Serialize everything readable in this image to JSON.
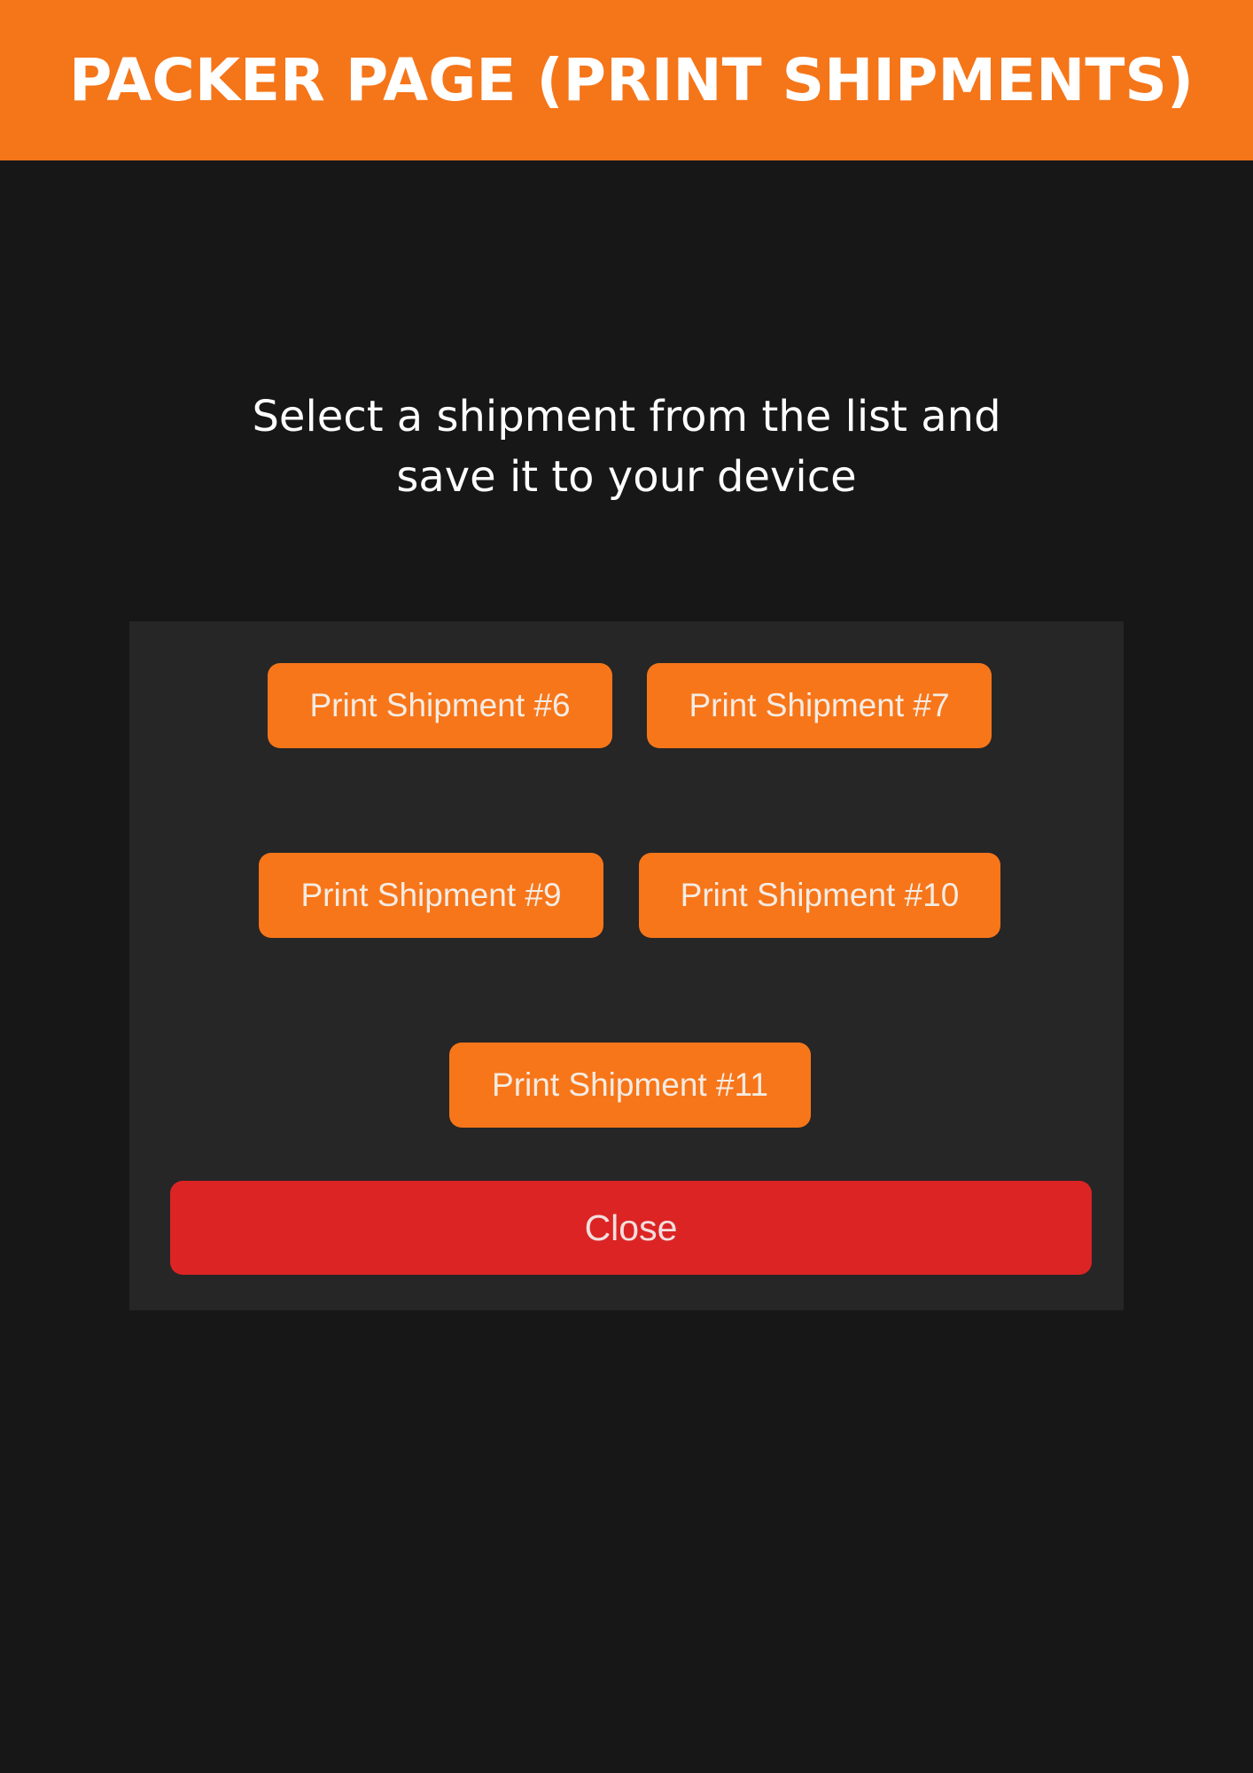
{
  "header": {
    "title": "PACKER PAGE (PRINT SHIPMENTS)",
    "background_color": "#f57519"
  },
  "instruction": {
    "text": "Select a shipment from the list and\nsave it to your device"
  },
  "shipment_buttons": [
    {
      "label": "Print Shipment #6"
    },
    {
      "label": "Print Shipment #7"
    },
    {
      "label": "Print Shipment #9"
    },
    {
      "label": "Print Shipment #10"
    },
    {
      "label": "Print Shipment #11"
    }
  ],
  "close_button": {
    "label": "Close",
    "color": "#dc2424"
  },
  "colors": {
    "page_background": "#171717",
    "panel_background": "#262626",
    "shipment_button": "#f7761a"
  }
}
